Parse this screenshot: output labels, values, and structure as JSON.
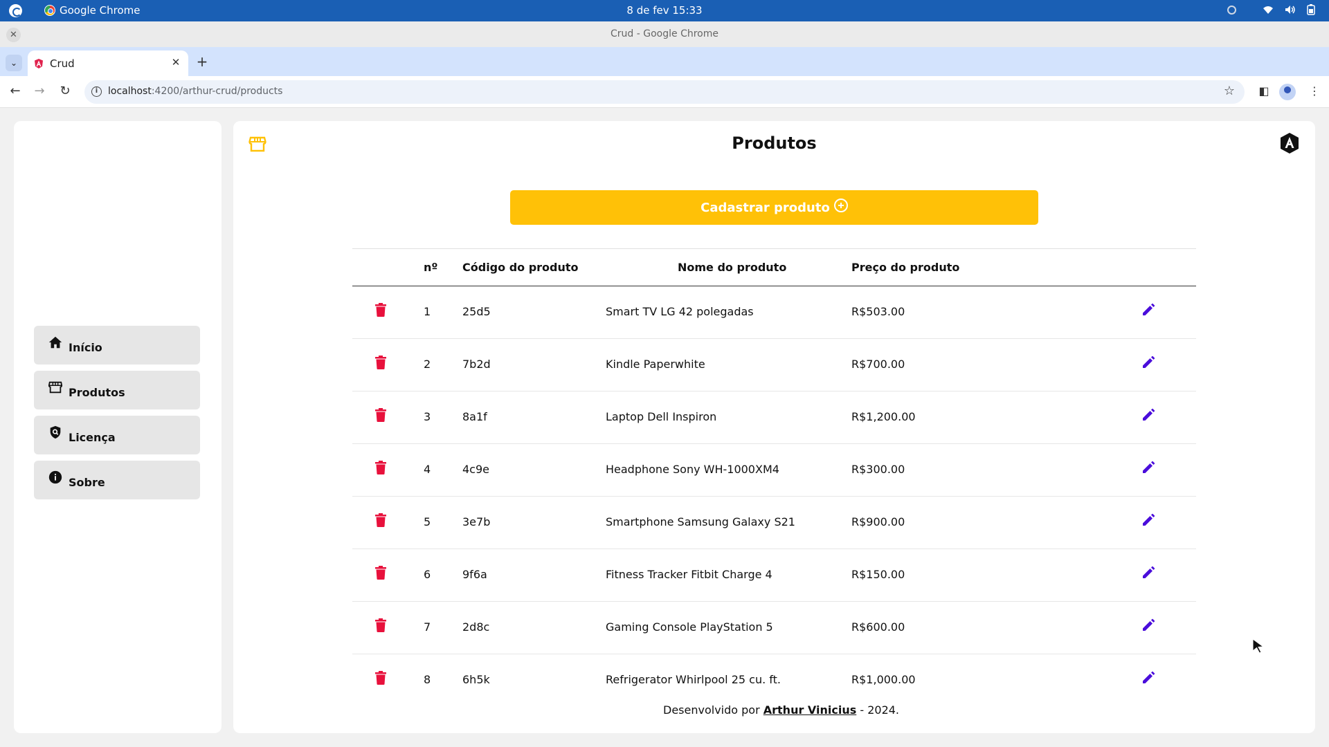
{
  "os_bar": {
    "app_name": "Google Chrome",
    "clock": "8 de fev  15:33"
  },
  "window": {
    "title": "Crud - Google Chrome"
  },
  "tabs": [
    {
      "label": "Crud",
      "active": true
    }
  ],
  "toolbar": {
    "url_host": "localhost",
    "url_rest": ":4200/arthur-crud/products"
  },
  "sidebar": {
    "items": [
      {
        "label": "Início",
        "icon": "home-icon"
      },
      {
        "label": "Produtos",
        "icon": "store-icon"
      },
      {
        "label": "Licença",
        "icon": "shield-search-icon"
      },
      {
        "label": "Sobre",
        "icon": "info-icon"
      }
    ]
  },
  "main": {
    "title": "Produtos",
    "cta_label": "Cadastrar produto"
  },
  "table": {
    "columns": [
      "nº",
      "Código do produto",
      "Nome do produto",
      "Preço do produto"
    ],
    "rows": [
      {
        "n": "1",
        "code": "25d5",
        "name": "Smart TV LG 42 polegadas",
        "price": "R$503.00"
      },
      {
        "n": "2",
        "code": "7b2d",
        "name": "Kindle Paperwhite",
        "price": "R$700.00"
      },
      {
        "n": "3",
        "code": "8a1f",
        "name": "Laptop Dell Inspiron",
        "price": "R$1,200.00"
      },
      {
        "n": "4",
        "code": "4c9e",
        "name": "Headphone Sony WH-1000XM4",
        "price": "R$300.00"
      },
      {
        "n": "5",
        "code": "3e7b",
        "name": "Smartphone Samsung Galaxy S21",
        "price": "R$900.00"
      },
      {
        "n": "6",
        "code": "9f6a",
        "name": "Fitness Tracker Fitbit Charge 4",
        "price": "R$150.00"
      },
      {
        "n": "7",
        "code": "2d8c",
        "name": "Gaming Console PlayStation 5",
        "price": "R$600.00"
      },
      {
        "n": "8",
        "code": "6h5k",
        "name": "Refrigerator Whirlpool 25 cu. ft.",
        "price": "R$1,000.00"
      }
    ]
  },
  "footer": {
    "prefix": "Desenvolvido por ",
    "author": "Arthur Vinicius",
    "suffix": " - 2024."
  },
  "colors": {
    "accent": "#ffc107",
    "delete": "#e8113c",
    "edit": "#4a0ddb",
    "os_bar": "#1a5fb4",
    "tab_strip": "#d3e3fd"
  }
}
